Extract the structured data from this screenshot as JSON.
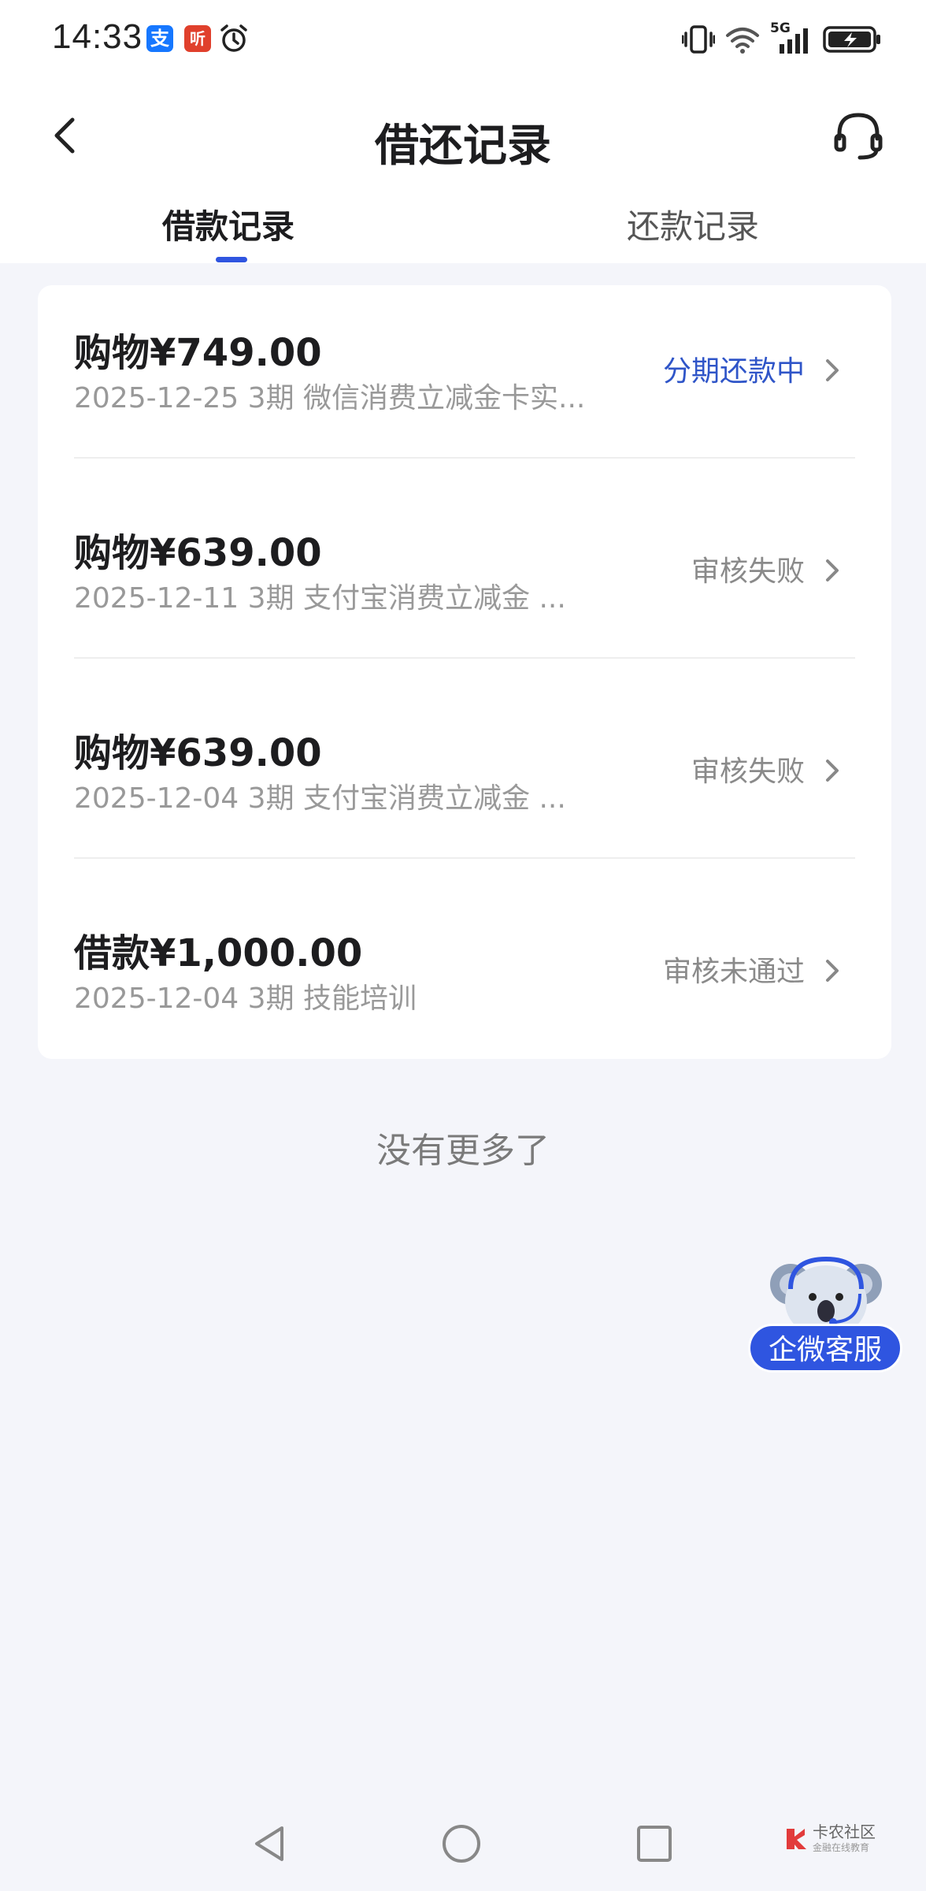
{
  "status_bar": {
    "time": "14:33",
    "app_icons": [
      "alipay-icon",
      "ting-icon",
      "alarm-icon"
    ],
    "right_icons": [
      "vibrate-icon",
      "wifi-icon",
      "5g-signal-icon",
      "battery-charging-icon"
    ],
    "network_label": "5G"
  },
  "header": {
    "title": "借还记录",
    "back_icon": "chevron-left-icon",
    "service_icon": "headset-icon"
  },
  "tabs": [
    {
      "label": "借款记录",
      "selected": true
    },
    {
      "label": "还款记录",
      "selected": false
    }
  ],
  "records": [
    {
      "amount": "购物¥749.00",
      "meta": "2025-12-25 3期  微信消费立减金卡实...",
      "status": "分期还款中",
      "status_active": true
    },
    {
      "amount": "购物¥639.00",
      "meta": "2025-12-11 3期  支付宝消费立减金 ...",
      "status": "审核失败",
      "status_active": false
    },
    {
      "amount": "购物¥639.00",
      "meta": "2025-12-04 3期  支付宝消费立减金 ...",
      "status": "审核失败",
      "status_active": false
    },
    {
      "amount": "借款¥1,000.00",
      "meta": "2025-12-04 3期  技能培训",
      "status": "审核未通过",
      "status_active": false
    }
  ],
  "footer_text": "没有更多了",
  "floating_service": {
    "label": "企微客服",
    "icon": "koala-mascot-icon"
  },
  "colors": {
    "accent": "#2f55e0",
    "status_active": "#2f55c8",
    "status_muted": "#8a8a8a",
    "background": "#f4f5fa"
  },
  "system_nav": {
    "buttons": [
      "back-triangle-icon",
      "home-circle-icon",
      "recents-square-icon"
    ],
    "watermark": "卡农社区",
    "watermark_sub": "金融在线教育"
  }
}
